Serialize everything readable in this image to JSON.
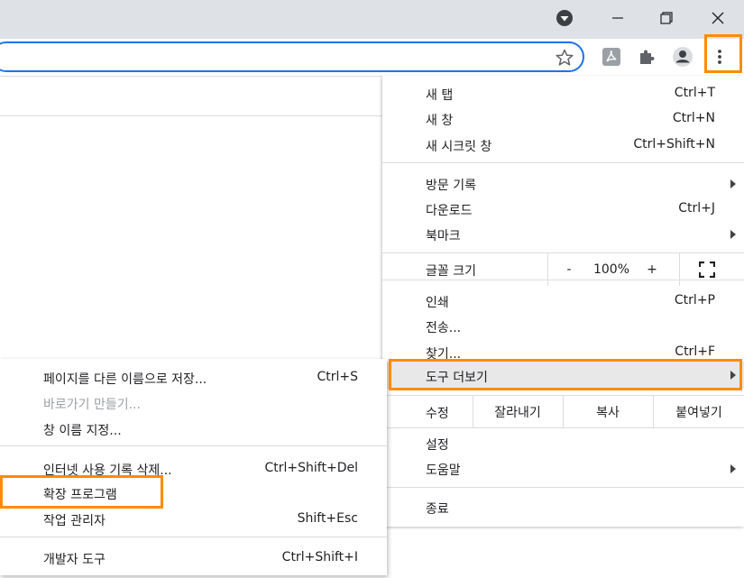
{
  "menu": {
    "new_tab": {
      "label": "새 탭",
      "shortcut": "Ctrl+T"
    },
    "new_window": {
      "label": "새 창",
      "shortcut": "Ctrl+N"
    },
    "incognito": {
      "label": "새 시크릿 창",
      "shortcut": "Ctrl+Shift+N"
    },
    "history": {
      "label": "방문 기록"
    },
    "downloads": {
      "label": "다운로드",
      "shortcut": "Ctrl+J"
    },
    "bookmarks": {
      "label": "북마크"
    },
    "zoom": {
      "label": "글꼴 크기",
      "minus": "-",
      "value": "100%",
      "plus": "+"
    },
    "print": {
      "label": "인쇄",
      "shortcut": "Ctrl+P"
    },
    "cast": {
      "label": "전송..."
    },
    "find": {
      "label": "찾기...",
      "shortcut": "Ctrl+F"
    },
    "more_tools": {
      "label": "도구 더보기"
    },
    "edit": {
      "label": "수정",
      "cut": "잘라내기",
      "copy": "복사",
      "paste": "붙여넣기"
    },
    "settings": {
      "label": "설정"
    },
    "help": {
      "label": "도움말"
    },
    "exit": {
      "label": "종료"
    }
  },
  "submenu": {
    "save_page": {
      "label": "페이지를 다른 이름으로 저장...",
      "shortcut": "Ctrl+S"
    },
    "create_shortcut": {
      "label": "바로가기 만들기..."
    },
    "name_window": {
      "label": "창 이름 지정..."
    },
    "clear_data": {
      "label": "인터넷 사용 기록 삭제...",
      "shortcut": "Ctrl+Shift+Del"
    },
    "extensions": {
      "label": "확장 프로그램"
    },
    "task_manager": {
      "label": "작업 관리자",
      "shortcut": "Shift+Esc"
    },
    "dev_tools": {
      "label": "개발자 도구",
      "shortcut": "Ctrl+Shift+I"
    }
  },
  "colors": {
    "highlight": "#ff8c00",
    "omnibox_border": "#1a73e8",
    "titlebar": "#dee1e6"
  }
}
